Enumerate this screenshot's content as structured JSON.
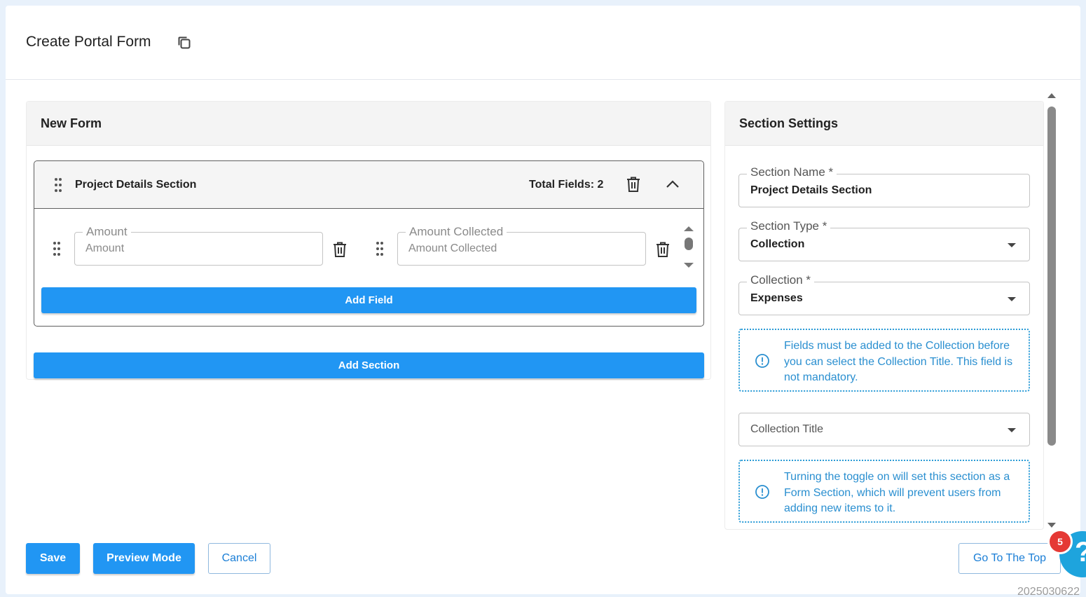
{
  "header": {
    "title": "Create Portal Form",
    "copy_icon": "copy-icon"
  },
  "form_panel": {
    "title": "New Form",
    "section": {
      "title": "Project Details Section",
      "total_fields": "Total Fields: 2",
      "fields": [
        {
          "legend": "Amount",
          "placeholder": "Amount"
        },
        {
          "legend": "Amount Collected",
          "placeholder": "Amount Collected"
        }
      ],
      "add_field_label": "Add Field"
    },
    "add_section_label": "Add Section"
  },
  "settings_panel": {
    "title": "Section Settings",
    "section_name": {
      "label": "Section Name *",
      "value": "Project Details Section"
    },
    "section_type": {
      "label": "Section Type *",
      "value": "Collection"
    },
    "collection": {
      "label": "Collection *",
      "value": "Expenses"
    },
    "info_collection": "Fields must be added to the Collection before you can select the Collection Title. This field is not mandatory.",
    "collection_title": {
      "placeholder": "Collection Title"
    },
    "info_toggle": "Turning the toggle on will set this section as a Form Section, which will prevent users from adding new items to it."
  },
  "footer": {
    "save_label": "Save",
    "preview_label": "Preview Mode",
    "cancel_label": "Cancel",
    "go_top_label": "Go To The Top",
    "help_badge_count": "5",
    "help_glyph": "?",
    "build_id": "2025030622"
  },
  "colors": {
    "primary": "#2196f3",
    "info": "#2a8fd0",
    "badge": "#e53935"
  }
}
